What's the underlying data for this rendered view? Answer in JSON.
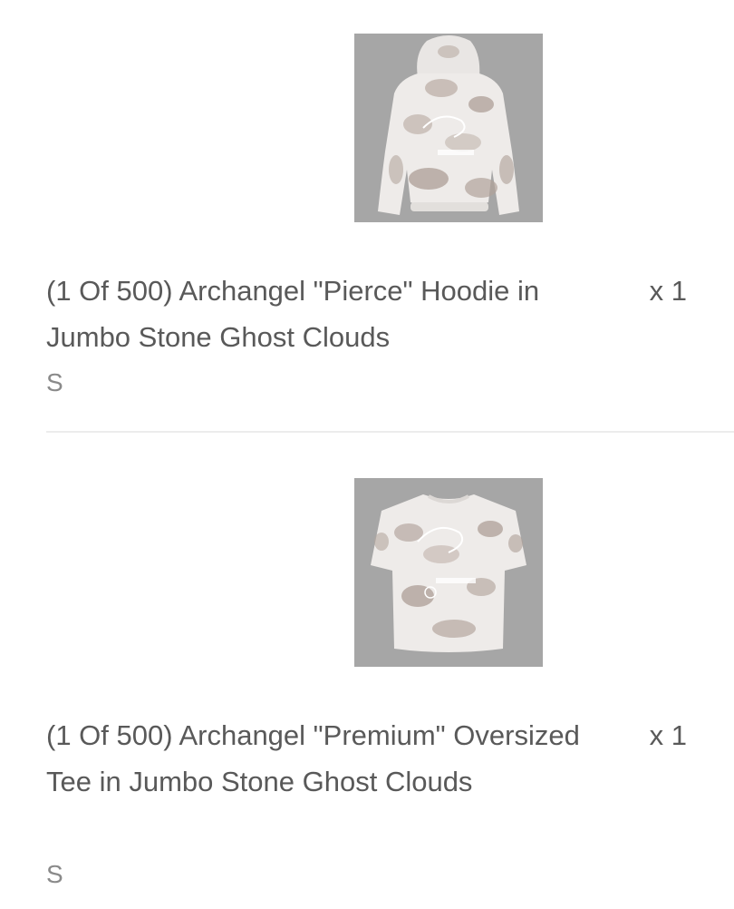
{
  "order_items": [
    {
      "image_alt": "Hoodie product photo",
      "title": "(1 Of 500) Archangel \"Pierce\" Hoodie in Jumbo Stone Ghost Clouds",
      "quantity": "x 1",
      "variant": "S"
    },
    {
      "image_alt": "Tee product photo",
      "title": "(1 Of 500) Archangel \"Premium\" Oversized Tee in Jumbo Stone Ghost Clouds",
      "quantity": "x 1",
      "variant": "S"
    }
  ],
  "colors": {
    "thumb_bg": "#a6a6a6",
    "text": "#595959",
    "muted": "#8a8a8a",
    "divider": "#ececec"
  }
}
